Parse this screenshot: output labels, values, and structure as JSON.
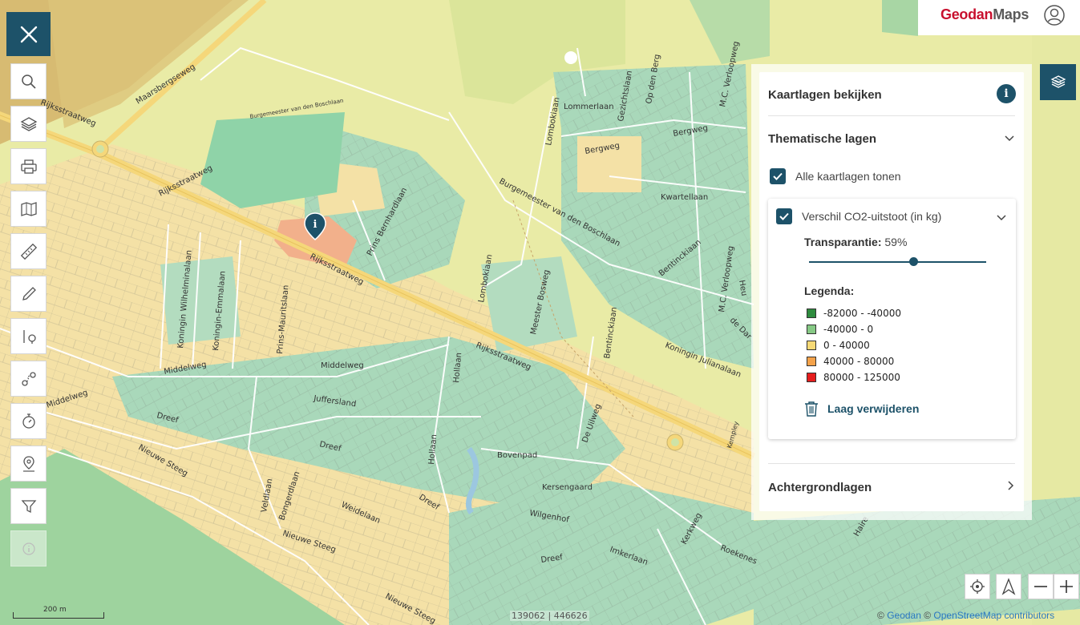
{
  "brand": {
    "part1": "Geodan",
    "part2": "Maps"
  },
  "panel": {
    "title": "Kaartlagen bekijken",
    "info_glyph": "i",
    "thematic": {
      "heading": "Thematische lagen",
      "show_all_label": "Alle kaartlagen tonen",
      "show_all_checked": true,
      "layer": {
        "name": "Verschil CO2-uitstoot (in kg)",
        "checked": true,
        "transparency_label": "Transparantie:",
        "transparency_value": "59%",
        "transparency_fraction": 0.59,
        "legend_title": "Legenda:",
        "legend": [
          {
            "label": "-82000 - -40000",
            "color": "#2e8b3e"
          },
          {
            "label": "-40000 - 0",
            "color": "#86c985"
          },
          {
            "label": "0 - 40000",
            "color": "#f6d976"
          },
          {
            "label": "40000 - 80000",
            "color": "#f4a24a"
          },
          {
            "label": "80000 - 125000",
            "color": "#e51d1d"
          }
        ],
        "remove_label": "Laag verwijderen"
      }
    },
    "background_heading": "Achtergrondlagen"
  },
  "toolbar": {
    "tools": [
      {
        "name": "search-icon"
      },
      {
        "name": "layers-icon"
      },
      {
        "name": "print-icon"
      },
      {
        "name": "map-edit-icon"
      },
      {
        "name": "ruler-icon"
      },
      {
        "name": "pencil-icon"
      },
      {
        "name": "route-point-icon"
      },
      {
        "name": "route-icon"
      },
      {
        "name": "stopwatch-icon"
      },
      {
        "name": "location-pin-icon"
      },
      {
        "name": "filter-icon"
      },
      {
        "name": "info-icon",
        "disabled": true
      }
    ]
  },
  "map": {
    "scale_label": "200 m",
    "coordinates": "139062 | 446626",
    "attribution": {
      "c1": "© ",
      "geodan": "Geodan",
      "c2": " © ",
      "osm": "OpenStreetMap contributors"
    },
    "streets": [
      "Maarsbergseweg",
      "Rijksstraatweg",
      "Rijksstraatweg",
      "Rijksstraatweg",
      "Rijksstraatweg",
      "Burgemeester van den Boschlaan",
      "Burgemeester van den Boschlaan",
      "Prins Bernhardlaan",
      "Koningin Wilhelminalaan",
      "Koningin-Emmalaan",
      "Prins-Mauritslaan",
      "Middelweg",
      "Middelweg",
      "Middelweg",
      "Juffersland",
      "Dreef",
      "Dreef",
      "Dreef",
      "Dreef",
      "Nieuwe Steeg",
      "Nieuwe Steeg",
      "Nieuwe Steeg",
      "Veldlaan",
      "Bongerdlaan",
      "Weidelaan",
      "Hollaan",
      "Hollaan",
      "Lombokiaan",
      "Lombokiaan",
      "Lommerlaan",
      "Gezichtslaan",
      "Op den Berg",
      "M.C. Verloopweg",
      "M.C. Verloopweg",
      "Bergweg",
      "Bergweg",
      "Kwartellaan",
      "Bentinckiaan",
      "Bentinckiaan",
      "Meester Bosweg",
      "Koningin Julianalaan",
      "De Uilweg",
      "Bovenpad",
      "Kersengaard",
      "Wilgenhof",
      "Kerkweg",
      "Roekenes",
      "Imkerlaan",
      "de Dar",
      "Heu",
      "Kempley",
      "Haire"
    ]
  },
  "colors": {
    "accent": "#1d5269",
    "brand_red": "#c8102e"
  }
}
